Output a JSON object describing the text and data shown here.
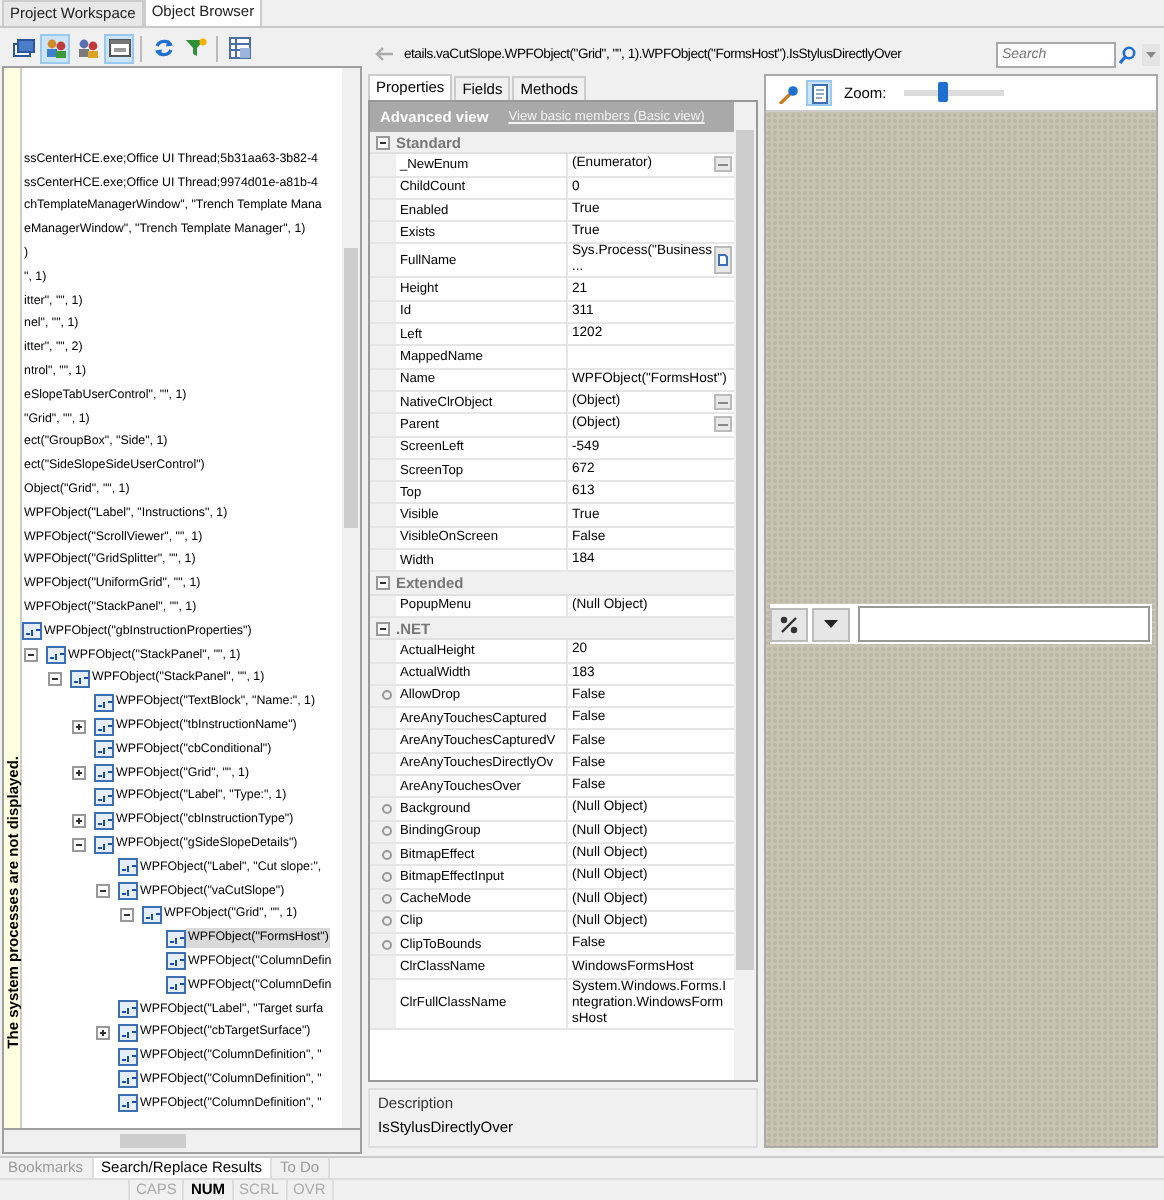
{
  "workspace_tabs": [
    {
      "label": "Project Workspace",
      "selected": false
    },
    {
      "label": "Object Browser",
      "selected": true
    }
  ],
  "browser_toolbar": [
    {
      "pressed": false
    },
    {
      "pressed": true
    },
    {
      "pressed": false
    },
    {
      "pressed": true
    },
    {
      "pressed": false
    },
    {
      "pressed": false
    },
    {
      "pressed": false
    }
  ],
  "hint_strip": "The system processes are not displayed.",
  "tree": {
    "clipped_rows": [
      {
        "label": "ssCenterHCE.exe;Office UI Thread;5b31aa63-3b82-4",
        "selected": false
      },
      {
        "label": "ssCenterHCE.exe;Office UI Thread;9974d01e-a81b-4",
        "selected": false
      },
      {
        "label": "chTemplateManagerWindow\", \"Trench Template Mana",
        "selected": false
      },
      {
        "label": "eManagerWindow\", \"Trench Template Manager\", 1)",
        "selected": false
      },
      {
        "label": ")",
        "selected": false
      },
      {
        "label": "\", 1)",
        "selected": false
      },
      {
        "label": "itter\", \"\", 1)",
        "selected": false
      },
      {
        "label": "nel\", \"\", 1)",
        "selected": false
      },
      {
        "label": "itter\", \"\", 2)",
        "selected": false
      },
      {
        "label": "ntrol\", \"\", 1)",
        "selected": false
      },
      {
        "label": "eSlopeTabUserControl\", \"\", 1)",
        "selected": false
      },
      {
        "label": "\"Grid\", \"\", 1)",
        "selected": false
      },
      {
        "label": "ect(\"GroupBox\", \"Side\", 1)",
        "selected": false
      },
      {
        "label": "ect(\"SideSlopeSideUserControl\")",
        "selected": false
      },
      {
        "label": "Object(\"Grid\", \"\", 1)",
        "selected": false
      }
    ],
    "nodes": [
      {
        "label": "WPFObject(\"Label\", \"Instructions\", 1)",
        "selected": false
      },
      {
        "label": "WPFObject(\"ScrollViewer\", \"\", 1)",
        "selected": false
      },
      {
        "label": "WPFObject(\"GridSplitter\", \"\", 1)",
        "selected": false
      },
      {
        "label": "WPFObject(\"UniformGrid\", \"\", 1)",
        "selected": false
      },
      {
        "label": "WPFObject(\"StackPanel\", \"\", 1)",
        "selected": false,
        "children": [
          {
            "label": "WPFObject(\"gbInstructionProperties\")",
            "selected": false,
            "children": [
              {
                "label": "WPFObject(\"StackPanel\", \"\", 1)",
                "selected": false,
                "expanded": true,
                "children": [
                  {
                    "label": "WPFObject(\"StackPanel\", \"\", 1)",
                    "selected": false,
                    "expanded": true,
                    "children": [
                      {
                        "label": "WPFObject(\"TextBlock\", \"Name:\", 1)",
                        "selected": false
                      },
                      {
                        "label": "WPFObject(\"tbInstructionName\")",
                        "selected": false,
                        "expanded": false
                      },
                      {
                        "label": "WPFObject(\"cbConditional\")",
                        "selected": false
                      },
                      {
                        "label": "WPFObject(\"Grid\", \"\", 1)",
                        "selected": false,
                        "expanded": false
                      },
                      {
                        "label": "WPFObject(\"Label\", \"Type:\", 1)",
                        "selected": false
                      },
                      {
                        "label": "WPFObject(\"cbInstructionType\")",
                        "selected": false,
                        "expanded": false
                      },
                      {
                        "label": "WPFObject(\"gSideSlopeDetails\")",
                        "selected": false,
                        "expanded": true,
                        "children": [
                          {
                            "label": "WPFObject(\"Label\", \"Cut slope:\",",
                            "selected": false
                          },
                          {
                            "label": "WPFObject(\"vaCutSlope\")",
                            "selected": false,
                            "expanded": true,
                            "children": [
                              {
                                "label": "WPFObject(\"Grid\", \"\", 1)",
                                "selected": false,
                                "expanded": true,
                                "children": [
                                  {
                                    "label": "WPFObject(\"FormsHost\")",
                                    "selected": true
                                  },
                                  {
                                    "label": "WPFObject(\"ColumnDefin",
                                    "selected": false
                                  },
                                  {
                                    "label": "WPFObject(\"ColumnDefin",
                                    "selected": false
                                  }
                                ]
                              }
                            ]
                          },
                          {
                            "label": "WPFObject(\"Label\", \"Target surfa",
                            "selected": false
                          },
                          {
                            "label": "WPFObject(\"cbTargetSurface\")",
                            "selected": false,
                            "expanded": false
                          },
                          {
                            "label": "WPFObject(\"ColumnDefinition\", \"",
                            "selected": false
                          },
                          {
                            "label": "WPFObject(\"ColumnDefinition\", \"",
                            "selected": false
                          },
                          {
                            "label": "WPFObject(\"ColumnDefinition\", \"",
                            "selected": false
                          }
                        ]
                      }
                    ]
                  }
                ]
              }
            ]
          }
        ]
      }
    ]
  },
  "path": {
    "text": "etails.vaCutSlope.WPFObject(\"Grid\", \"\", 1).WPFObject(\"FormsHost\").IsStylusDirectlyOver",
    "search_placeholder": "Search"
  },
  "inspector_tabs": [
    {
      "label": "Properties",
      "selected": true
    },
    {
      "label": "Fields",
      "selected": false
    },
    {
      "label": "Methods",
      "selected": false
    }
  ],
  "property_grid": {
    "view_title": "Advanced view",
    "view_link": "View basic members (Basic view)",
    "sections": [
      {
        "title": "Standard",
        "expanded": true,
        "rows": [
          {
            "name": "_NewEnum",
            "value": "(Enumerator)",
            "marker": false,
            "kind": "ellipsis"
          },
          {
            "name": "ChildCount",
            "value": "0",
            "marker": false
          },
          {
            "name": "Enabled",
            "value": "True",
            "marker": false
          },
          {
            "name": "Exists",
            "value": "True",
            "marker": false
          },
          {
            "name": "FullName",
            "value": "Sys.Process(\"Business\n...",
            "marker": false,
            "kind": "document"
          },
          {
            "name": "Height",
            "value": "21",
            "marker": false
          },
          {
            "name": "Id",
            "value": "311",
            "marker": false
          },
          {
            "name": "Left",
            "value": "1202",
            "marker": false
          },
          {
            "name": "MappedName",
            "value": "",
            "marker": false
          },
          {
            "name": "Name",
            "value": "WPFObject(\"FormsHost\")",
            "marker": false
          },
          {
            "name": "NativeClrObject",
            "value": "(Object)",
            "marker": false,
            "kind": "ellipsis"
          },
          {
            "name": "Parent",
            "value": "(Object)",
            "marker": false,
            "kind": "ellipsis"
          },
          {
            "name": "ScreenLeft",
            "value": "-549",
            "marker": false
          },
          {
            "name": "ScreenTop",
            "value": "672",
            "marker": false
          },
          {
            "name": "Top",
            "value": "613",
            "marker": false
          },
          {
            "name": "Visible",
            "value": "True",
            "marker": false
          },
          {
            "name": "VisibleOnScreen",
            "value": "False",
            "marker": false
          },
          {
            "name": "Width",
            "value": "184",
            "marker": false
          }
        ]
      },
      {
        "title": "Extended",
        "expanded": true,
        "rows": [
          {
            "name": "PopupMenu",
            "value": "(Null Object)",
            "marker": false
          }
        ]
      },
      {
        "title": ".NET",
        "expanded": true,
        "rows": [
          {
            "name": "ActualHeight",
            "value": "20",
            "marker": false
          },
          {
            "name": "ActualWidth",
            "value": "183",
            "marker": false
          },
          {
            "name": "AllowDrop",
            "value": "False",
            "marker": true
          },
          {
            "name": "AreAnyTouchesCaptured",
            "value": "False",
            "marker": false
          },
          {
            "name": "AreAnyTouchesCapturedV",
            "value": "False",
            "marker": false
          },
          {
            "name": "AreAnyTouchesDirectlyOv",
            "value": "False",
            "marker": false
          },
          {
            "name": "AreAnyTouchesOver",
            "value": "False",
            "marker": false
          },
          {
            "name": "Background",
            "value": "(Null Object)",
            "marker": true
          },
          {
            "name": "BindingGroup",
            "value": "(Null Object)",
            "marker": true
          },
          {
            "name": "BitmapEffect",
            "value": "(Null Object)",
            "marker": true
          },
          {
            "name": "BitmapEffectInput",
            "value": "(Null Object)",
            "marker": true
          },
          {
            "name": "CacheMode",
            "value": "(Null Object)",
            "marker": true
          },
          {
            "name": "Clip",
            "value": "(Null Object)",
            "marker": true
          },
          {
            "name": "ClipToBounds",
            "value": "False",
            "marker": true
          },
          {
            "name": "ClrClassName",
            "value": "WindowsFormsHost",
            "marker": false
          },
          {
            "name": "ClrFullClassName",
            "value": "System.Windows.Forms.I\nntegration.WindowsForm\nsHost",
            "marker": false
          }
        ]
      }
    ]
  },
  "description": {
    "title": "Description",
    "text": "IsStylusDirectlyOver"
  },
  "preview": {
    "toolbar": [
      {
        "pressed": false
      },
      {
        "pressed": true
      }
    ],
    "zoom_label": "Zoom:",
    "zoom": {
      "level": 0.38
    }
  },
  "bottom_tabs": [
    {
      "label": "Bookmarks",
      "selected": false
    },
    {
      "label": "Search/Replace Results",
      "selected": true
    },
    {
      "label": "To Do",
      "selected": false
    }
  ],
  "status_bar": [
    {
      "label": "CAPS",
      "on": false
    },
    {
      "label": "NUM",
      "on": true
    },
    {
      "label": "SCRL",
      "on": false
    },
    {
      "label": "OVR",
      "on": false
    }
  ]
}
